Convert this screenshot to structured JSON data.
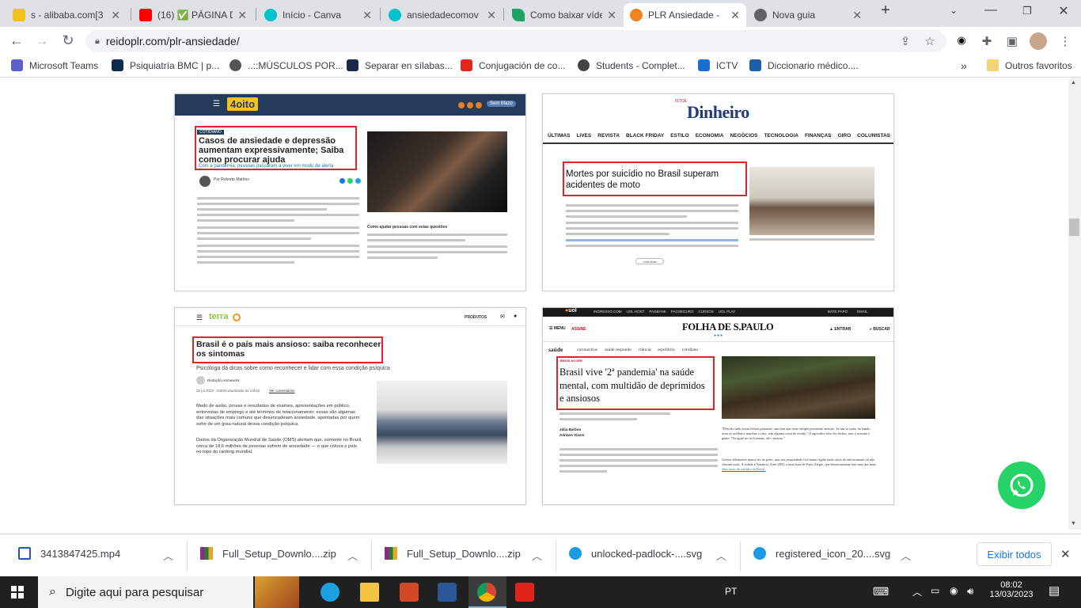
{
  "tabs": [
    {
      "title": "s - alibaba.com[3",
      "color": "#f3c21c"
    },
    {
      "title": "(16) ✅ PÁGINA D",
      "color": "#ff0000"
    },
    {
      "title": "Início - Canva",
      "color": "#00c4cc"
    },
    {
      "title": "ansiedadecomov",
      "color": "#00c4cc"
    },
    {
      "title": "Como baixar víde",
      "color": "#1ea362"
    },
    {
      "title": "PLR Ansiedade -",
      "color": "#f58220"
    },
    {
      "title": "Nova guia",
      "color": "#5f6368"
    }
  ],
  "new_tab_label": "+",
  "address": {
    "url": "reidoplr.com/plr-ansiedade/"
  },
  "bookmarks": [
    {
      "label": "Microsoft Teams",
      "color": "#5b5fc7"
    },
    {
      "label": "Psiquiatría BMC | p...",
      "color": "#0d2b4e"
    },
    {
      "label": "..::MÚSCULOS POR...",
      "color": "#555555"
    },
    {
      "label": "Separar en sílabas...",
      "color": "#1b2a4a"
    },
    {
      "label": "Conjugación de co...",
      "color": "#e1261c"
    },
    {
      "label": "Students - Complet...",
      "color": "#444444"
    },
    {
      "label": "ICTV",
      "color": "#1c6dd0"
    },
    {
      "label": "Diccionario médico....",
      "color": "#1f5fa8"
    }
  ],
  "other_bookmarks": "Outros favoritos",
  "cards": {
    "c1": {
      "logo": "4oito",
      "tag": "COTIDIANO",
      "headline": "Casos de ansiedade e depressão aumentam expressivamente; Saiba como procurar ajuda",
      "subtitle": "Com a pandemia, pessoas passaram a viver em modo de alerta",
      "author": "Por Roberto Martins",
      "side_caption": "Como ajudar pessoas com estas questões",
      "button": "Sem Mazo"
    },
    "c2": {
      "logo": "Dinheiro",
      "logo_small": "ISTOÉ",
      "nav": [
        "ÚLTIMAS",
        "LIVES",
        "REVISTA",
        "BLACK FRIDAY",
        "ESTILO",
        "ECONOMIA",
        "NEGÓCIOS",
        "TECNOLOGIA",
        "FINANÇAS",
        "GIRO",
        "COLUNISTAS"
      ],
      "headline": "Mortes por suicídio no Brasil superam acidentes de moto",
      "more": "Leia Mais"
    },
    "c3": {
      "logo": "terra",
      "menu": "PRODUTOS",
      "headline": "Brasil é o país mais ansioso: saiba reconhecer os sintomas",
      "subtitle": "Psicóloga dá dicas sobre como reconhecer e lidar com essa condição psíquica",
      "author": "Redação Homework",
      "date": "25 jul 2022 - 04h00",
      "updated": "atualizado às 13h42",
      "comments": "Ver comentários",
      "p1": "Medo de avião, provas e resultados de exames, apresentações em público, entrevistas de emprego e até términos de relacionamento: essas são algumas das situações mais comuns que desencadeiam ansiedade, apontadas por quem sofre de um grau natural dessa condição psíquica.",
      "p2": "Dados da Organização Mundial de Saúde (OMS) alertam que, somente no Brasil, cerca de 18,6 milhões de pessoas sofrem de ansiedade — o que coloca o país no topo do ranking mundial."
    },
    "c4": {
      "topnav": [
        "INGRESSO.COM",
        "UOL HOST",
        "PAGBANK",
        "PAGSEGURO",
        "CURSOS",
        "UOL PLAY"
      ],
      "top_right": [
        "BATE-PAPO",
        "EMAIL"
      ],
      "menu": "MENU",
      "subscribe": "ASSINE",
      "logo": "FOLHA DE S.PAULO",
      "enter": "ENTRAR",
      "search": "BUSCAR",
      "section": "saúde",
      "subnav": [
        "coronavírus",
        "saúde responde",
        "ciência",
        "equilíbrio",
        "cotidiano"
      ],
      "kicker": "BRASIL NO SEM",
      "headline": "Brasil vive '2ª pandemia' na saúde mental, com multidão de deprimidos e ansiosos",
      "authors": [
        "Júlia Barbon",
        "Adriano Vizoni"
      ],
      "right_text": "\"Eles tão tudo assim felizes pastando, mas tem que estar sempre prestando atenção. Se um se isolar do bando, urrar as orelhas e murchar o rabo, tem alguma coisa de errado.\" O agricultor fala dos bichos, mas o assunto é gente: \"Eu igual no ser humano, dá o mesmo.\"",
      "right_text2": "Gerson felizmente nunca viu de perto, mas seu propriedade fica numa região onde casos de enforcamento já não chocam mais. A cidade é Venâncio Aires (RS), a uma hora de Porto Alegre, que historicamente tem uma das mais",
      "link": "altas taxas de suicídio do Brasil."
    }
  },
  "downloads": [
    {
      "name": "3413847425.mp4",
      "color": "#1e5bb8"
    },
    {
      "name": "Full_Setup_Downlo....zip",
      "color": "#8b2a8b"
    },
    {
      "name": "Full_Setup_Downlo....zip",
      "color": "#8b2a8b"
    },
    {
      "name": "unlocked-padlock-....svg",
      "color": "#1a9be6"
    },
    {
      "name": "registered_icon_20....svg",
      "color": "#1a9be6"
    }
  ],
  "show_all": "Exibir todos",
  "taskbar": {
    "search_placeholder": "Digite aqui para pesquisar",
    "lang": "PT",
    "time": "08:02",
    "date": "13/03/2023"
  }
}
